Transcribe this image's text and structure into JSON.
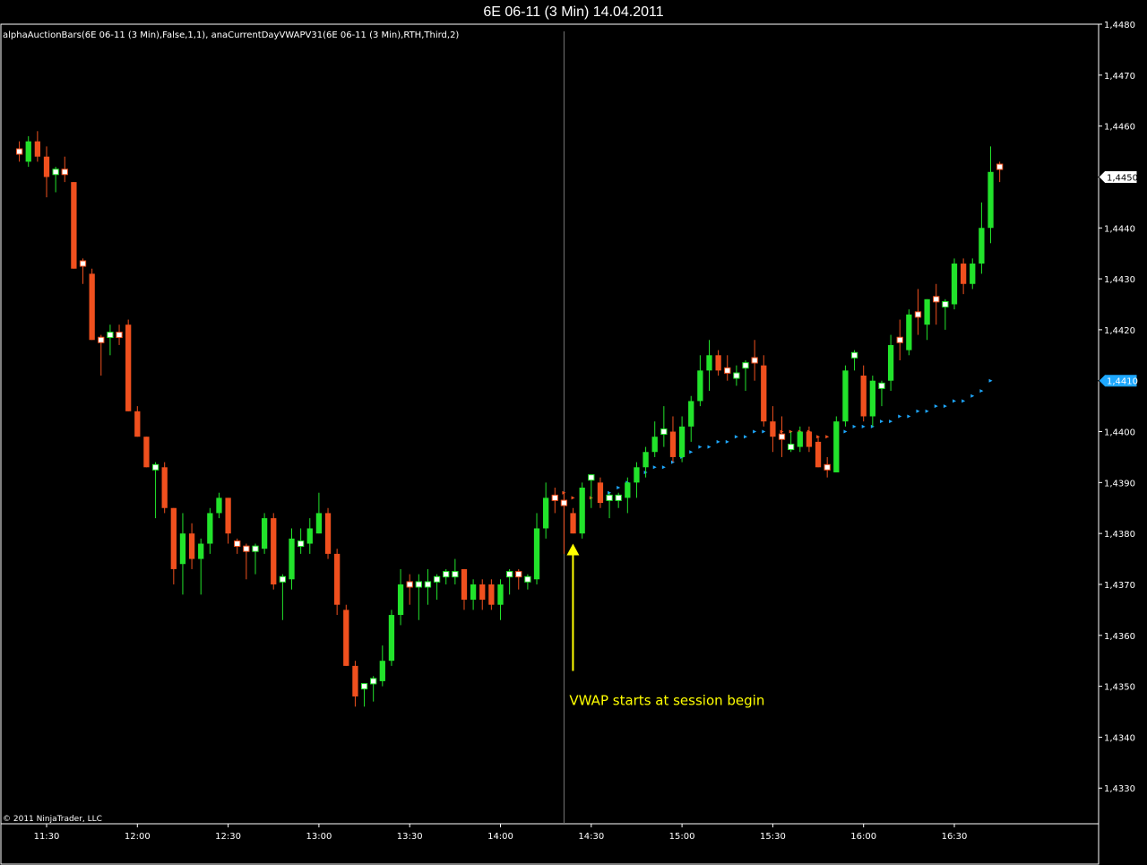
{
  "window": {
    "title": "6E 06-11 (3 Min)  14.04.2011"
  },
  "indicators": {
    "label": "alphaAuctionBars(6E 06-11 (3 Min),False,1,1), anaCurrentDayVWAPV31(6E 06-11 (3 Min),RTH,Third,2)"
  },
  "footer": {
    "copyright": "© 2011 NinjaTrader, LLC"
  },
  "annotation": {
    "text": "VWAP starts at session begin",
    "color": "#ffff00",
    "x": "14:21",
    "arrow_tip_y": 1.4378,
    "arrow_tail_y": 1.4353
  },
  "colors": {
    "up": "#22e32b",
    "down": "#f0501e",
    "vwap_up": "#1ea8ff",
    "vwap_down": "#f0501e",
    "last_price_bg": "#ffffff",
    "vwap_label_bg": "#1ea8ff"
  },
  "chart_data": {
    "type": "candlestick",
    "title": "6E 06-11 (3 Min)  14.04.2011",
    "bar_interval_minutes": 3,
    "ylim": [
      1.4323,
      1.448
    ],
    "y_ticks": [
      "1,4330",
      "1,4340",
      "1,4350",
      "1,4360",
      "1,4370",
      "1,4380",
      "1,4390",
      "1,4400",
      "1,4410",
      "1,4420",
      "1,4430",
      "1,4440",
      "1,4450",
      "1,4460",
      "1,4470",
      "1,4480"
    ],
    "x_ticks": [
      "11:30",
      "12:00",
      "12:30",
      "13:00",
      "13:30",
      "14:00",
      "14:30",
      "15:00",
      "15:30",
      "16:00",
      "16:30"
    ],
    "session_start": "14:21",
    "last_price_label": "1,4450",
    "vwap_label": "1,4410",
    "candles": [
      {
        "t": "11:21",
        "o": 1.4455,
        "h": 1.4457,
        "l": 1.4453,
        "c": 1.4453
      },
      {
        "t": "11:24",
        "o": 1.4453,
        "h": 1.4458,
        "l": 1.4452,
        "c": 1.4457
      },
      {
        "t": "11:27",
        "o": 1.4457,
        "h": 1.4459,
        "l": 1.4453,
        "c": 1.4454
      },
      {
        "t": "11:30",
        "o": 1.4454,
        "h": 1.4456,
        "l": 1.4446,
        "c": 1.445
      },
      {
        "t": "11:33",
        "o": 1.4449,
        "h": 1.4452,
        "l": 1.4447,
        "c": 1.4451
      },
      {
        "t": "11:36",
        "o": 1.4451,
        "h": 1.4454,
        "l": 1.4449,
        "c": 1.445
      },
      {
        "t": "11:39",
        "o": 1.4449,
        "h": 1.4449,
        "l": 1.4432,
        "c": 1.4432
      },
      {
        "t": "11:42",
        "o": 1.4433,
        "h": 1.4434,
        "l": 1.4429,
        "c": 1.4431
      },
      {
        "t": "11:45",
        "o": 1.4431,
        "h": 1.4432,
        "l": 1.4418,
        "c": 1.4418
      },
      {
        "t": "11:48",
        "o": 1.4418,
        "h": 1.4419,
        "l": 1.4411,
        "c": 1.4417
      },
      {
        "t": "11:51",
        "o": 1.4417,
        "h": 1.4421,
        "l": 1.4415,
        "c": 1.4419
      },
      {
        "t": "11:54",
        "o": 1.4419,
        "h": 1.4421,
        "l": 1.4417,
        "c": 1.4418
      },
      {
        "t": "11:57",
        "o": 1.4421,
        "h": 1.4422,
        "l": 1.4404,
        "c": 1.4404
      },
      {
        "t": "12:00",
        "o": 1.4404,
        "h": 1.4405,
        "l": 1.4399,
        "c": 1.4399
      },
      {
        "t": "12:03",
        "o": 1.4399,
        "h": 1.4399,
        "l": 1.4393,
        "c": 1.4393
      },
      {
        "t": "12:06",
        "o": 1.4393,
        "h": 1.4394,
        "l": 1.4383,
        "c": 1.4393
      },
      {
        "t": "12:09",
        "o": 1.4393,
        "h": 1.4394,
        "l": 1.4384,
        "c": 1.4385
      },
      {
        "t": "12:12",
        "o": 1.4385,
        "h": 1.4385,
        "l": 1.437,
        "c": 1.4373
      },
      {
        "t": "12:15",
        "o": 1.4374,
        "h": 1.4384,
        "l": 1.4368,
        "c": 1.438
      },
      {
        "t": "12:18",
        "o": 1.438,
        "h": 1.4382,
        "l": 1.4373,
        "c": 1.4375
      },
      {
        "t": "12:21",
        "o": 1.4375,
        "h": 1.4379,
        "l": 1.4368,
        "c": 1.4378
      },
      {
        "t": "12:24",
        "o": 1.4378,
        "h": 1.4385,
        "l": 1.4376,
        "c": 1.4384
      },
      {
        "t": "12:27",
        "o": 1.4384,
        "h": 1.4388,
        "l": 1.4383,
        "c": 1.4387
      },
      {
        "t": "12:30",
        "o": 1.4387,
        "h": 1.4387,
        "l": 1.4378,
        "c": 1.438
      },
      {
        "t": "12:33",
        "o": 1.4378,
        "h": 1.4379,
        "l": 1.4376,
        "c": 1.4377
      },
      {
        "t": "12:36",
        "o": 1.4377,
        "h": 1.4378,
        "l": 1.4371,
        "c": 1.4375
      },
      {
        "t": "12:39",
        "o": 1.4375,
        "h": 1.4378,
        "l": 1.4372,
        "c": 1.4377
      },
      {
        "t": "12:42",
        "o": 1.4377,
        "h": 1.4384,
        "l": 1.4376,
        "c": 1.4383
      },
      {
        "t": "12:45",
        "o": 1.4383,
        "h": 1.4384,
        "l": 1.4369,
        "c": 1.437
      },
      {
        "t": "12:48",
        "o": 1.437,
        "h": 1.4372,
        "l": 1.4363,
        "c": 1.4371
      },
      {
        "t": "12:51",
        "o": 1.4371,
        "h": 1.4381,
        "l": 1.4369,
        "c": 1.4379
      },
      {
        "t": "12:54",
        "o": 1.4377,
        "h": 1.4381,
        "l": 1.4376,
        "c": 1.4378
      },
      {
        "t": "12:57",
        "o": 1.4378,
        "h": 1.4383,
        "l": 1.4376,
        "c": 1.4381
      },
      {
        "t": "13:00",
        "o": 1.438,
        "h": 1.4388,
        "l": 1.438,
        "c": 1.4384
      },
      {
        "t": "13:03",
        "o": 1.4384,
        "h": 1.4385,
        "l": 1.4375,
        "c": 1.4376
      },
      {
        "t": "13:06",
        "o": 1.4376,
        "h": 1.4377,
        "l": 1.4364,
        "c": 1.4366
      },
      {
        "t": "13:09",
        "o": 1.4365,
        "h": 1.4366,
        "l": 1.4354,
        "c": 1.4354
      },
      {
        "t": "13:12",
        "o": 1.4354,
        "h": 1.4355,
        "l": 1.4346,
        "c": 1.4348
      },
      {
        "t": "13:15",
        "o": 1.4348,
        "h": 1.435,
        "l": 1.4346,
        "c": 1.435
      },
      {
        "t": "13:18",
        "o": 1.435,
        "h": 1.4352,
        "l": 1.4347,
        "c": 1.4351
      },
      {
        "t": "13:21",
        "o": 1.4351,
        "h": 1.4358,
        "l": 1.435,
        "c": 1.4355
      },
      {
        "t": "13:24",
        "o": 1.4355,
        "h": 1.4365,
        "l": 1.4354,
        "c": 1.4364
      },
      {
        "t": "13:27",
        "o": 1.4364,
        "h": 1.4373,
        "l": 1.4362,
        "c": 1.437
      },
      {
        "t": "13:30",
        "o": 1.437,
        "h": 1.4372,
        "l": 1.4366,
        "c": 1.4368
      },
      {
        "t": "13:33",
        "o": 1.4368,
        "h": 1.4372,
        "l": 1.4363,
        "c": 1.437
      },
      {
        "t": "13:36",
        "o": 1.437,
        "h": 1.4373,
        "l": 1.4366,
        "c": 1.437
      },
      {
        "t": "13:39",
        "o": 1.437,
        "h": 1.4372,
        "l": 1.4367,
        "c": 1.4371
      },
      {
        "t": "13:42",
        "o": 1.4371,
        "h": 1.4373,
        "l": 1.437,
        "c": 1.4372
      },
      {
        "t": "13:45",
        "o": 1.4372,
        "h": 1.4375,
        "l": 1.437,
        "c": 1.4372
      },
      {
        "t": "13:48",
        "o": 1.4373,
        "h": 1.4373,
        "l": 1.4365,
        "c": 1.4367
      },
      {
        "t": "13:51",
        "o": 1.4367,
        "h": 1.4371,
        "l": 1.4365,
        "c": 1.437
      },
      {
        "t": "13:54",
        "o": 1.437,
        "h": 1.4371,
        "l": 1.4365,
        "c": 1.4367
      },
      {
        "t": "13:57",
        "o": 1.437,
        "h": 1.4371,
        "l": 1.4365,
        "c": 1.4366
      },
      {
        "t": "14:00",
        "o": 1.4366,
        "h": 1.4371,
        "l": 1.4363,
        "c": 1.437
      },
      {
        "t": "14:03",
        "o": 1.437,
        "h": 1.4373,
        "l": 1.4368,
        "c": 1.4372
      },
      {
        "t": "14:06",
        "o": 1.4372,
        "h": 1.4373,
        "l": 1.4369,
        "c": 1.437
      },
      {
        "t": "14:09",
        "o": 1.437,
        "h": 1.4372,
        "l": 1.4369,
        "c": 1.4371
      },
      {
        "t": "14:12",
        "o": 1.4371,
        "h": 1.4384,
        "l": 1.437,
        "c": 1.4381
      },
      {
        "t": "14:15",
        "o": 1.4381,
        "h": 1.439,
        "l": 1.4379,
        "c": 1.4387
      },
      {
        "t": "14:18",
        "o": 1.4387,
        "h": 1.4389,
        "l": 1.4384,
        "c": 1.4386
      },
      {
        "t": "14:21",
        "o": 1.4386,
        "h": 1.4388,
        "l": 1.4376,
        "c": 1.4384
      },
      {
        "t": "14:24",
        "o": 1.4384,
        "h": 1.4385,
        "l": 1.438,
        "c": 1.438
      },
      {
        "t": "14:27",
        "o": 1.438,
        "h": 1.439,
        "l": 1.4379,
        "c": 1.4389
      },
      {
        "t": "14:30",
        "o": 1.4389,
        "h": 1.4391,
        "l": 1.4385,
        "c": 1.4391
      },
      {
        "t": "14:33",
        "o": 1.439,
        "h": 1.4391,
        "l": 1.4385,
        "c": 1.4386
      },
      {
        "t": "14:36",
        "o": 1.4386,
        "h": 1.4388,
        "l": 1.4383,
        "c": 1.4387
      },
      {
        "t": "14:39",
        "o": 1.4386,
        "h": 1.4388,
        "l": 1.4385,
        "c": 1.4387
      },
      {
        "t": "14:42",
        "o": 1.4387,
        "h": 1.4391,
        "l": 1.4384,
        "c": 1.439
      },
      {
        "t": "14:45",
        "o": 1.439,
        "h": 1.4394,
        "l": 1.4387,
        "c": 1.4393
      },
      {
        "t": "14:48",
        "o": 1.4393,
        "h": 1.4397,
        "l": 1.4391,
        "c": 1.4396
      },
      {
        "t": "14:51",
        "o": 1.4396,
        "h": 1.4402,
        "l": 1.4395,
        "c": 1.4399
      },
      {
        "t": "14:54",
        "o": 1.4399,
        "h": 1.4405,
        "l": 1.4397,
        "c": 1.44
      },
      {
        "t": "14:57",
        "o": 1.44,
        "h": 1.4403,
        "l": 1.4394,
        "c": 1.4395
      },
      {
        "t": "15:00",
        "o": 1.4395,
        "h": 1.4403,
        "l": 1.4394,
        "c": 1.4401
      },
      {
        "t": "15:03",
        "o": 1.4401,
        "h": 1.4407,
        "l": 1.4398,
        "c": 1.4406
      },
      {
        "t": "15:06",
        "o": 1.4406,
        "h": 1.4415,
        "l": 1.4405,
        "c": 1.4412
      },
      {
        "t": "15:09",
        "o": 1.4412,
        "h": 1.4418,
        "l": 1.4408,
        "c": 1.4415
      },
      {
        "t": "15:12",
        "o": 1.4415,
        "h": 1.4416,
        "l": 1.4411,
        "c": 1.4412
      },
      {
        "t": "15:15",
        "o": 1.4412,
        "h": 1.4415,
        "l": 1.441,
        "c": 1.4411
      },
      {
        "t": "15:18",
        "o": 1.4411,
        "h": 1.4413,
        "l": 1.4409,
        "c": 1.4411
      },
      {
        "t": "15:21",
        "o": 1.4411,
        "h": 1.4414,
        "l": 1.4408,
        "c": 1.4413
      },
      {
        "t": "15:24",
        "o": 1.4414,
        "h": 1.4418,
        "l": 1.441,
        "c": 1.4412
      },
      {
        "t": "15:27",
        "o": 1.4413,
        "h": 1.4415,
        "l": 1.4401,
        "c": 1.4402
      },
      {
        "t": "15:30",
        "o": 1.4402,
        "h": 1.4405,
        "l": 1.4396,
        "c": 1.4399
      },
      {
        "t": "15:33",
        "o": 1.4399,
        "h": 1.4403,
        "l": 1.4395,
        "c": 1.4397
      },
      {
        "t": "15:36",
        "o": 1.4397,
        "h": 1.44,
        "l": 1.4396,
        "c": 1.4397
      },
      {
        "t": "15:39",
        "o": 1.4397,
        "h": 1.4401,
        "l": 1.4396,
        "c": 1.44
      },
      {
        "t": "15:42",
        "o": 1.44,
        "h": 1.4401,
        "l": 1.4396,
        "c": 1.4397
      },
      {
        "t": "15:45",
        "o": 1.4398,
        "h": 1.4399,
        "l": 1.4393,
        "c": 1.4393
      },
      {
        "t": "15:48",
        "o": 1.4393,
        "h": 1.4395,
        "l": 1.4391,
        "c": 1.4392
      },
      {
        "t": "15:51",
        "o": 1.4392,
        "h": 1.4403,
        "l": 1.4392,
        "c": 1.4402
      },
      {
        "t": "15:54",
        "o": 1.4402,
        "h": 1.4413,
        "l": 1.4401,
        "c": 1.4412
      },
      {
        "t": "15:57",
        "o": 1.4413,
        "h": 1.4416,
        "l": 1.4412,
        "c": 1.4415
      },
      {
        "t": "16:00",
        "o": 1.4411,
        "h": 1.4413,
        "l": 1.4402,
        "c": 1.4403
      },
      {
        "t": "16:03",
        "o": 1.4403,
        "h": 1.4411,
        "l": 1.4401,
        "c": 1.441
      },
      {
        "t": "16:06",
        "o": 1.4409,
        "h": 1.441,
        "l": 1.4405,
        "c": 1.4409
      },
      {
        "t": "16:09",
        "o": 1.441,
        "h": 1.4419,
        "l": 1.4408,
        "c": 1.4417
      },
      {
        "t": "16:12",
        "o": 1.4418,
        "h": 1.4422,
        "l": 1.4414,
        "c": 1.4416
      },
      {
        "t": "16:15",
        "o": 1.4416,
        "h": 1.4424,
        "l": 1.4415,
        "c": 1.4423
      },
      {
        "t": "16:18",
        "o": 1.4423,
        "h": 1.4428,
        "l": 1.4419,
        "c": 1.4421
      },
      {
        "t": "16:21",
        "o": 1.4421,
        "h": 1.4426,
        "l": 1.4418,
        "c": 1.4426
      },
      {
        "t": "16:24",
        "o": 1.4426,
        "h": 1.4429,
        "l": 1.4421,
        "c": 1.4425
      },
      {
        "t": "16:27",
        "o": 1.4425,
        "h": 1.4426,
        "l": 1.442,
        "c": 1.4425
      },
      {
        "t": "16:30",
        "o": 1.4425,
        "h": 1.4434,
        "l": 1.4424,
        "c": 1.4433
      },
      {
        "t": "16:33",
        "o": 1.4433,
        "h": 1.4434,
        "l": 1.4427,
        "c": 1.4429
      },
      {
        "t": "16:36",
        "o": 1.4429,
        "h": 1.4434,
        "l": 1.4428,
        "c": 1.4433
      },
      {
        "t": "16:39",
        "o": 1.4433,
        "h": 1.4445,
        "l": 1.4431,
        "c": 1.444
      },
      {
        "t": "16:42",
        "o": 1.444,
        "h": 1.4456,
        "l": 1.4437,
        "c": 1.4451
      },
      {
        "t": "16:45",
        "o": 1.4452,
        "h": 1.4453,
        "l": 1.4449,
        "c": 1.445
      }
    ],
    "vwap": [
      {
        "t": "14:21",
        "v": 1.4388,
        "dir": "down"
      },
      {
        "t": "14:24",
        "v": 1.4387,
        "dir": "down"
      },
      {
        "t": "14:27",
        "v": 1.4388,
        "dir": "down"
      },
      {
        "t": "14:30",
        "v": 1.4387,
        "dir": "down"
      },
      {
        "t": "14:33",
        "v": 1.4388,
        "dir": "up"
      },
      {
        "t": "14:36",
        "v": 1.4388,
        "dir": "up"
      },
      {
        "t": "14:39",
        "v": 1.4389,
        "dir": "up"
      },
      {
        "t": "14:42",
        "v": 1.439,
        "dir": "up"
      },
      {
        "t": "14:45",
        "v": 1.4391,
        "dir": "up"
      },
      {
        "t": "14:48",
        "v": 1.4392,
        "dir": "up"
      },
      {
        "t": "14:51",
        "v": 1.4393,
        "dir": "up"
      },
      {
        "t": "14:54",
        "v": 1.4393,
        "dir": "up"
      },
      {
        "t": "14:57",
        "v": 1.4394,
        "dir": "up"
      },
      {
        "t": "15:00",
        "v": 1.4395,
        "dir": "up"
      },
      {
        "t": "15:03",
        "v": 1.4396,
        "dir": "up"
      },
      {
        "t": "15:06",
        "v": 1.4397,
        "dir": "up"
      },
      {
        "t": "15:09",
        "v": 1.4397,
        "dir": "up"
      },
      {
        "t": "15:12",
        "v": 1.4398,
        "dir": "up"
      },
      {
        "t": "15:15",
        "v": 1.4398,
        "dir": "up"
      },
      {
        "t": "15:18",
        "v": 1.4399,
        "dir": "up"
      },
      {
        "t": "15:21",
        "v": 1.4399,
        "dir": "up"
      },
      {
        "t": "15:24",
        "v": 1.44,
        "dir": "up"
      },
      {
        "t": "15:27",
        "v": 1.44,
        "dir": "up"
      },
      {
        "t": "15:30",
        "v": 1.44,
        "dir": "down"
      },
      {
        "t": "15:33",
        "v": 1.44,
        "dir": "down"
      },
      {
        "t": "15:36",
        "v": 1.44,
        "dir": "down"
      },
      {
        "t": "15:39",
        "v": 1.44,
        "dir": "down"
      },
      {
        "t": "15:42",
        "v": 1.44,
        "dir": "down"
      },
      {
        "t": "15:45",
        "v": 1.4399,
        "dir": "down"
      },
      {
        "t": "15:48",
        "v": 1.4399,
        "dir": "down"
      },
      {
        "t": "15:51",
        "v": 1.44,
        "dir": "up"
      },
      {
        "t": "15:54",
        "v": 1.44,
        "dir": "up"
      },
      {
        "t": "15:57",
        "v": 1.4401,
        "dir": "up"
      },
      {
        "t": "16:00",
        "v": 1.4401,
        "dir": "up"
      },
      {
        "t": "16:03",
        "v": 1.4401,
        "dir": "up"
      },
      {
        "t": "16:06",
        "v": 1.4402,
        "dir": "up"
      },
      {
        "t": "16:09",
        "v": 1.4402,
        "dir": "up"
      },
      {
        "t": "16:12",
        "v": 1.4403,
        "dir": "up"
      },
      {
        "t": "16:15",
        "v": 1.4403,
        "dir": "up"
      },
      {
        "t": "16:18",
        "v": 1.4404,
        "dir": "up"
      },
      {
        "t": "16:21",
        "v": 1.4404,
        "dir": "up"
      },
      {
        "t": "16:24",
        "v": 1.4405,
        "dir": "up"
      },
      {
        "t": "16:27",
        "v": 1.4405,
        "dir": "up"
      },
      {
        "t": "16:30",
        "v": 1.4406,
        "dir": "up"
      },
      {
        "t": "16:33",
        "v": 1.4406,
        "dir": "up"
      },
      {
        "t": "16:36",
        "v": 1.4407,
        "dir": "up"
      },
      {
        "t": "16:39",
        "v": 1.4408,
        "dir": "up"
      },
      {
        "t": "16:42",
        "v": 1.441,
        "dir": "up"
      }
    ]
  }
}
